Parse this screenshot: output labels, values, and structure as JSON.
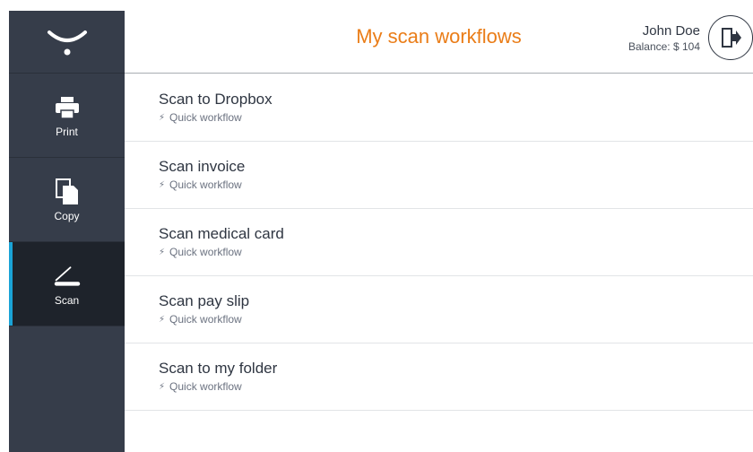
{
  "header": {
    "title": "My scan workflows",
    "user_name": "John Doe",
    "balance": "Balance: $ 104"
  },
  "sidebar": {
    "items": [
      {
        "label": "Print",
        "icon": "printer-icon"
      },
      {
        "label": "Copy",
        "icon": "copy-icon"
      },
      {
        "label": "Scan",
        "icon": "scanner-icon",
        "active": true
      }
    ]
  },
  "workflows": [
    {
      "title": "Scan to Dropbox",
      "subtitle": "Quick workflow"
    },
    {
      "title": "Scan invoice",
      "subtitle": "Quick workflow"
    },
    {
      "title": "Scan medical card",
      "subtitle": "Quick workflow"
    },
    {
      "title": "Scan pay slip",
      "subtitle": "Quick workflow"
    },
    {
      "title": "Scan to my folder",
      "subtitle": "Quick workflow"
    }
  ],
  "colors": {
    "accent": "#ea7d18",
    "sidebar": "#363d4a",
    "active_indicator": "#1aa3d6"
  }
}
